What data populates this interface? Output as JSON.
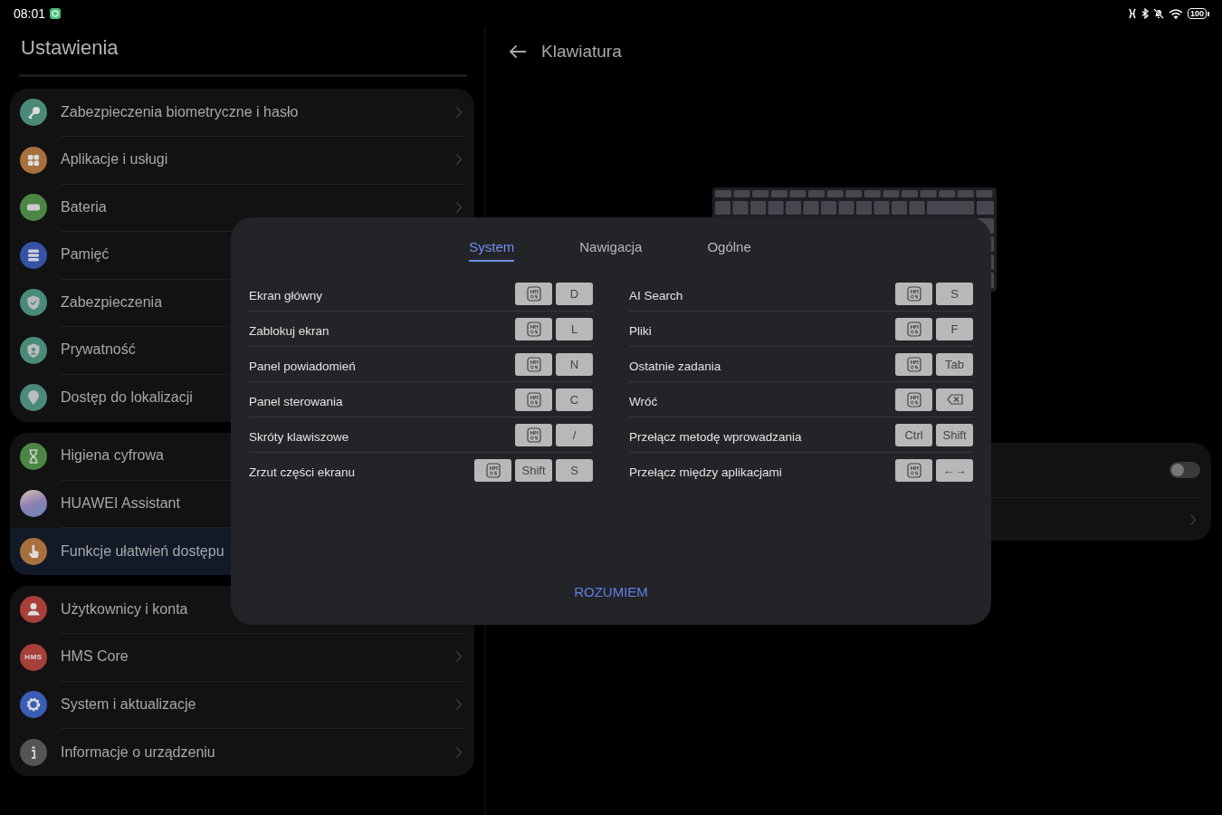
{
  "status_bar": {
    "time": "08:01",
    "battery": "100"
  },
  "settings": {
    "title": "Ustawienia",
    "groups": [
      {
        "items": [
          {
            "label": "Zabezpieczenia biometryczne i hasło",
            "kind": "key",
            "color": "#4a8a78",
            "selected": false
          },
          {
            "label": "Aplikacje i usługi",
            "kind": "apps",
            "color": "#a8703e",
            "selected": false
          },
          {
            "label": "Bateria",
            "kind": "battery",
            "color": "#4c8644",
            "selected": false
          },
          {
            "label": "Pamięć",
            "kind": "storage",
            "color": "#3552a6",
            "selected": false
          },
          {
            "label": "Zabezpieczenia",
            "kind": "shield",
            "color": "#4a8a78",
            "selected": false
          },
          {
            "label": "Prywatność",
            "kind": "privacy",
            "color": "#4a8a78",
            "selected": false
          },
          {
            "label": "Dostęp do lokalizacji",
            "kind": "pin",
            "color": "#4a8a78",
            "selected": false
          }
        ]
      },
      {
        "items": [
          {
            "label": "Higiena cyfrowa",
            "kind": "hourglass",
            "color": "#4c8644",
            "selected": false
          },
          {
            "label": "HUAWEI Assistant",
            "kind": "orb",
            "color": "#8c80b4",
            "selected": false
          },
          {
            "label": "Funkcje ułatwień dostępu",
            "kind": "hand",
            "color": "#a8703e",
            "selected": true
          }
        ]
      },
      {
        "items": [
          {
            "label": "Użytkownicy i konta",
            "kind": "user",
            "color": "#a8403a",
            "selected": false
          },
          {
            "label": "HMS Core",
            "kind": "badge",
            "badge": "HMS",
            "color": "#a8403a",
            "selected": false
          },
          {
            "label": "System i aktualizacje",
            "kind": "gear",
            "color": "#3a5cb4",
            "selected": false
          },
          {
            "label": "Informacje o urządzeniu",
            "kind": "info",
            "color": "#555555",
            "selected": false
          }
        ]
      }
    ]
  },
  "detail": {
    "title": "Klawiatura",
    "toggle_row": {
      "on": false
    }
  },
  "dialog": {
    "tabs": [
      {
        "label": "System",
        "selected": true
      },
      {
        "label": "Nawigacja",
        "selected": false
      },
      {
        "label": "Ogólne",
        "selected": false
      }
    ],
    "columns": [
      [
        {
          "label": "Ekran główny",
          "keys": [
            {
              "kind": "logo"
            },
            {
              "kind": "text",
              "label": "D"
            }
          ]
        },
        {
          "label": "Zablokuj ekran",
          "keys": [
            {
              "kind": "logo"
            },
            {
              "kind": "text",
              "label": "L"
            }
          ]
        },
        {
          "label": "Panel powiadomień",
          "keys": [
            {
              "kind": "logo"
            },
            {
              "kind": "text",
              "label": "N"
            }
          ]
        },
        {
          "label": "Panel sterowania",
          "keys": [
            {
              "kind": "logo"
            },
            {
              "kind": "text",
              "label": "C"
            }
          ]
        },
        {
          "label": "Skróty klawiszowe",
          "keys": [
            {
              "kind": "logo"
            },
            {
              "kind": "text",
              "label": "/"
            }
          ]
        },
        {
          "label": "Zrzut części ekranu",
          "keys": [
            {
              "kind": "logo"
            },
            {
              "kind": "text",
              "label": "Shift"
            },
            {
              "kind": "text",
              "label": "S"
            }
          ]
        }
      ],
      [
        {
          "label": "AI Search",
          "keys": [
            {
              "kind": "logo"
            },
            {
              "kind": "text",
              "label": "S"
            }
          ]
        },
        {
          "label": "Pliki",
          "keys": [
            {
              "kind": "logo"
            },
            {
              "kind": "text",
              "label": "F"
            }
          ]
        },
        {
          "label": "Ostatnie zadania",
          "keys": [
            {
              "kind": "logo"
            },
            {
              "kind": "text",
              "label": "Tab"
            }
          ]
        },
        {
          "label": "Wróć",
          "keys": [
            {
              "kind": "logo"
            },
            {
              "kind": "backspace"
            }
          ]
        },
        {
          "label": "Przełącz metodę wprowadzania",
          "keys": [
            {
              "kind": "text",
              "label": "Ctrl"
            },
            {
              "kind": "text",
              "label": "Shift"
            }
          ]
        },
        {
          "label": "Przełącz między aplikacjami",
          "keys": [
            {
              "kind": "logo"
            },
            {
              "kind": "text",
              "label": "←→"
            }
          ]
        }
      ]
    ],
    "confirm": "ROZUMIEM"
  }
}
